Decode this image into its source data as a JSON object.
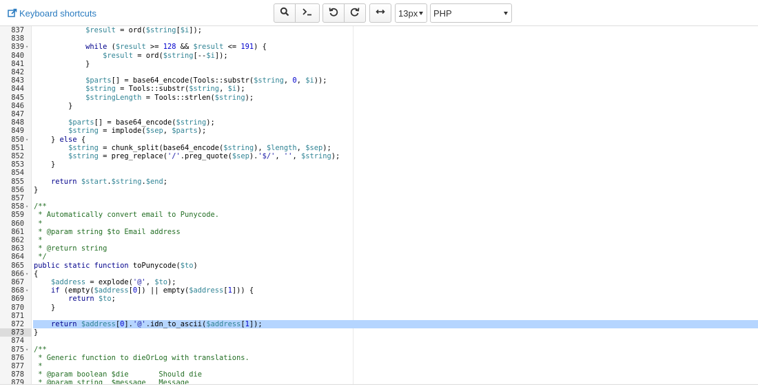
{
  "toolbar": {
    "keyboard_shortcuts_label": "Keyboard shortcuts",
    "font_size": "13px",
    "language": "PHP",
    "buttons": [
      "search-icon",
      "terminal-icon",
      "undo-icon",
      "redo-icon",
      "wrap-toggle-icon"
    ]
  },
  "editor": {
    "active_line": "873",
    "lines": [
      {
        "n": "837",
        "fold": "",
        "indent": 12,
        "tokens": [
          [
            "var",
            "$result"
          ],
          [
            "op",
            " = ord("
          ],
          [
            "var",
            "$string"
          ],
          [
            "op",
            "["
          ],
          [
            "var",
            "$i"
          ],
          [
            "op",
            "]);"
          ]
        ]
      },
      {
        "n": "838",
        "fold": "",
        "indent": 0,
        "tokens": []
      },
      {
        "n": "839",
        "fold": "▾",
        "indent": 12,
        "tokens": [
          [
            "kw",
            "while"
          ],
          [
            "op",
            " ("
          ],
          [
            "var",
            "$result"
          ],
          [
            "op",
            " >= "
          ],
          [
            "num",
            "128"
          ],
          [
            "op",
            " && "
          ],
          [
            "var",
            "$result"
          ],
          [
            "op",
            " <= "
          ],
          [
            "num",
            "191"
          ],
          [
            "op",
            ") {"
          ]
        ]
      },
      {
        "n": "840",
        "fold": "",
        "indent": 16,
        "tokens": [
          [
            "var",
            "$result"
          ],
          [
            "op",
            " = ord("
          ],
          [
            "var",
            "$string"
          ],
          [
            "op",
            "[--"
          ],
          [
            "var",
            "$i"
          ],
          [
            "op",
            "]);"
          ]
        ]
      },
      {
        "n": "841",
        "fold": "",
        "indent": 12,
        "tokens": [
          [
            "op",
            "}"
          ]
        ]
      },
      {
        "n": "842",
        "fold": "",
        "indent": 0,
        "tokens": []
      },
      {
        "n": "843",
        "fold": "",
        "indent": 12,
        "tokens": [
          [
            "var",
            "$parts"
          ],
          [
            "op",
            "[] = base64_encode(Tools::substr("
          ],
          [
            "var",
            "$string"
          ],
          [
            "op",
            ", "
          ],
          [
            "num",
            "0"
          ],
          [
            "op",
            ", "
          ],
          [
            "var",
            "$i"
          ],
          [
            "op",
            "));"
          ]
        ]
      },
      {
        "n": "844",
        "fold": "",
        "indent": 12,
        "tokens": [
          [
            "var",
            "$string"
          ],
          [
            "op",
            " = Tools::substr("
          ],
          [
            "var",
            "$string"
          ],
          [
            "op",
            ", "
          ],
          [
            "var",
            "$i"
          ],
          [
            "op",
            ");"
          ]
        ]
      },
      {
        "n": "845",
        "fold": "",
        "indent": 12,
        "tokens": [
          [
            "var",
            "$stringLength"
          ],
          [
            "op",
            " = Tools::strlen("
          ],
          [
            "var",
            "$string"
          ],
          [
            "op",
            ");"
          ]
        ]
      },
      {
        "n": "846",
        "fold": "",
        "indent": 8,
        "tokens": [
          [
            "op",
            "}"
          ]
        ]
      },
      {
        "n": "847",
        "fold": "",
        "indent": 0,
        "tokens": []
      },
      {
        "n": "848",
        "fold": "",
        "indent": 8,
        "tokens": [
          [
            "var",
            "$parts"
          ],
          [
            "op",
            "[] = base64_encode("
          ],
          [
            "var",
            "$string"
          ],
          [
            "op",
            ");"
          ]
        ]
      },
      {
        "n": "849",
        "fold": "",
        "indent": 8,
        "tokens": [
          [
            "var",
            "$string"
          ],
          [
            "op",
            " = implode("
          ],
          [
            "var",
            "$sep"
          ],
          [
            "op",
            ", "
          ],
          [
            "var",
            "$parts"
          ],
          [
            "op",
            ");"
          ]
        ]
      },
      {
        "n": "850",
        "fold": "▾",
        "indent": 4,
        "tokens": [
          [
            "op",
            "} "
          ],
          [
            "kw",
            "else"
          ],
          [
            "op",
            " {"
          ]
        ]
      },
      {
        "n": "851",
        "fold": "",
        "indent": 8,
        "tokens": [
          [
            "var",
            "$string"
          ],
          [
            "op",
            " = chunk_split(base64_encode("
          ],
          [
            "var",
            "$string"
          ],
          [
            "op",
            "), "
          ],
          [
            "var",
            "$length"
          ],
          [
            "op",
            ", "
          ],
          [
            "var",
            "$sep"
          ],
          [
            "op",
            ");"
          ]
        ]
      },
      {
        "n": "852",
        "fold": "",
        "indent": 8,
        "tokens": [
          [
            "var",
            "$string"
          ],
          [
            "op",
            " = preg_replace("
          ],
          [
            "str",
            "'/'"
          ],
          [
            "op",
            ".preg_quote("
          ],
          [
            "var",
            "$sep"
          ],
          [
            "op",
            ")."
          ],
          [
            "str",
            "'$/'"
          ],
          [
            "op",
            ", "
          ],
          [
            "str",
            "''"
          ],
          [
            "op",
            ", "
          ],
          [
            "var",
            "$string"
          ],
          [
            "op",
            ");"
          ]
        ]
      },
      {
        "n": "853",
        "fold": "",
        "indent": 4,
        "tokens": [
          [
            "op",
            "}"
          ]
        ]
      },
      {
        "n": "854",
        "fold": "",
        "indent": 0,
        "tokens": []
      },
      {
        "n": "855",
        "fold": "",
        "indent": 4,
        "tokens": [
          [
            "kw",
            "return"
          ],
          [
            "op",
            " "
          ],
          [
            "var",
            "$start"
          ],
          [
            "op",
            "."
          ],
          [
            "var",
            "$string"
          ],
          [
            "op",
            "."
          ],
          [
            "var",
            "$end"
          ],
          [
            "op",
            ";"
          ]
        ]
      },
      {
        "n": "856",
        "fold": "",
        "indent": 0,
        "tokens": [
          [
            "op",
            "}"
          ]
        ]
      },
      {
        "n": "857",
        "fold": "",
        "indent": 0,
        "tokens": []
      },
      {
        "n": "858",
        "fold": "▾",
        "indent": 0,
        "tokens": [
          [
            "cmt",
            "/**"
          ]
        ]
      },
      {
        "n": "859",
        "fold": "",
        "indent": 0,
        "tokens": [
          [
            "cmt",
            " * Automatically convert email to Punycode."
          ]
        ]
      },
      {
        "n": "860",
        "fold": "",
        "indent": 0,
        "tokens": [
          [
            "cmt",
            " *"
          ]
        ]
      },
      {
        "n": "861",
        "fold": "",
        "indent": 0,
        "tokens": [
          [
            "cmt",
            " * @param string $to Email address"
          ]
        ]
      },
      {
        "n": "862",
        "fold": "",
        "indent": 0,
        "tokens": [
          [
            "cmt",
            " *"
          ]
        ]
      },
      {
        "n": "863",
        "fold": "",
        "indent": 0,
        "tokens": [
          [
            "cmt",
            " * @return string"
          ]
        ]
      },
      {
        "n": "864",
        "fold": "",
        "indent": 0,
        "tokens": [
          [
            "cmt",
            " */"
          ]
        ]
      },
      {
        "n": "865",
        "fold": "",
        "indent": 0,
        "tokens": [
          [
            "kw",
            "public static function"
          ],
          [
            "op",
            " toPunycode("
          ],
          [
            "var",
            "$to"
          ],
          [
            "op",
            ")"
          ]
        ]
      },
      {
        "n": "866",
        "fold": "▾",
        "indent": 0,
        "tokens": [
          [
            "op",
            "{"
          ]
        ]
      },
      {
        "n": "867",
        "fold": "",
        "indent": 4,
        "tokens": [
          [
            "var",
            "$address"
          ],
          [
            "op",
            " = explode("
          ],
          [
            "str",
            "'@'"
          ],
          [
            "op",
            ", "
          ],
          [
            "var",
            "$to"
          ],
          [
            "op",
            ");"
          ]
        ]
      },
      {
        "n": "868",
        "fold": "▾",
        "indent": 4,
        "tokens": [
          [
            "kw",
            "if"
          ],
          [
            "op",
            " (empty("
          ],
          [
            "var",
            "$address"
          ],
          [
            "op",
            "["
          ],
          [
            "num",
            "0"
          ],
          [
            "op",
            "]) || empty("
          ],
          [
            "var",
            "$address"
          ],
          [
            "op",
            "["
          ],
          [
            "num",
            "1"
          ],
          [
            "op",
            "])) {"
          ]
        ]
      },
      {
        "n": "869",
        "fold": "",
        "indent": 8,
        "tokens": [
          [
            "kw",
            "return"
          ],
          [
            "op",
            " "
          ],
          [
            "var",
            "$to"
          ],
          [
            "op",
            ";"
          ]
        ]
      },
      {
        "n": "870",
        "fold": "",
        "indent": 4,
        "tokens": [
          [
            "op",
            "}"
          ]
        ]
      },
      {
        "n": "871",
        "fold": "",
        "indent": 0,
        "tokens": []
      },
      {
        "n": "872",
        "fold": "",
        "indent": 4,
        "tokens": [
          [
            "kw",
            "return"
          ],
          [
            "op",
            " "
          ],
          [
            "var",
            "$address"
          ],
          [
            "op",
            "["
          ],
          [
            "num",
            "0"
          ],
          [
            "op",
            "]."
          ],
          [
            "str",
            "'@'"
          ],
          [
            "op",
            ".idn_to_ascii("
          ],
          [
            "var",
            "$address"
          ],
          [
            "op",
            "["
          ],
          [
            "num",
            "1"
          ],
          [
            "op",
            "]);"
          ]
        ]
      },
      {
        "n": "873",
        "fold": "",
        "indent": 0,
        "tokens": [
          [
            "op",
            "}"
          ]
        ]
      },
      {
        "n": "874",
        "fold": "",
        "indent": 0,
        "tokens": []
      },
      {
        "n": "875",
        "fold": "▾",
        "indent": 0,
        "tokens": [
          [
            "cmt",
            "/**"
          ]
        ]
      },
      {
        "n": "876",
        "fold": "",
        "indent": 0,
        "tokens": [
          [
            "cmt",
            " * Generic function to dieOrLog with translations."
          ]
        ]
      },
      {
        "n": "877",
        "fold": "",
        "indent": 0,
        "tokens": [
          [
            "cmt",
            " *"
          ]
        ]
      },
      {
        "n": "878",
        "fold": "",
        "indent": 0,
        "tokens": [
          [
            "cmt",
            " * @param boolean $die       Should die"
          ]
        ]
      },
      {
        "n": "879",
        "fold": "",
        "indent": 0,
        "tokens": [
          [
            "cmt",
            " * @param string  $message   Message"
          ]
        ]
      }
    ]
  }
}
